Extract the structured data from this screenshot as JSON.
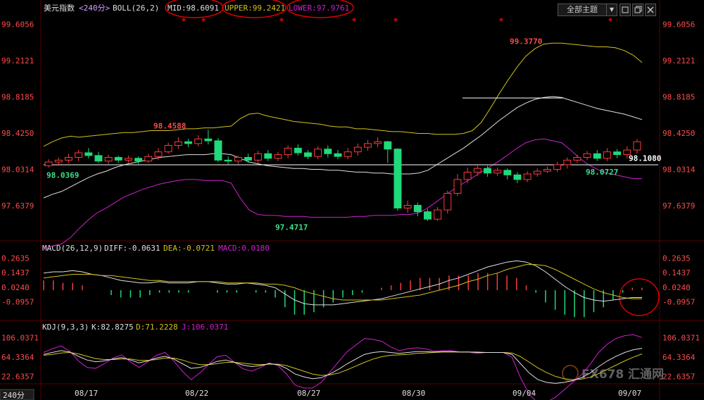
{
  "header": {
    "instrument": "美元指数",
    "period": "<240分>",
    "indicator": "BOLL(26,2)",
    "mid": "MID:98.6091",
    "upper": "UPPER:99.2421",
    "lower": "LOWER:97.9761",
    "theme_button": "全部主题",
    "theme_arrow": "▼"
  },
  "macd_header": {
    "name": "MACD(26,12,9)",
    "diff": "DIFF:-0.0631",
    "dea": "DEA:-0.0721",
    "macd": "MACD:0.0180"
  },
  "kdj_header": {
    "name": "KDJ(9,3,3)",
    "k": "K:82.8275",
    "d": "D:71.2228",
    "j": "J:106.0371"
  },
  "bottom_badge": "240分",
  "watermark": "FX678 汇通网",
  "colors": {
    "up": "#ff3a3a",
    "down": "#1fd97a",
    "mid": "#e0e0e0",
    "upper": "#d4c21a",
    "lower": "#d020d0",
    "annotation": "#ff0000"
  },
  "chart_data": [
    {
      "type": "candlestick",
      "title": "美元指数 <240分> BOLL(26,2)",
      "x_labels": [
        "08/17",
        "08/22",
        "08/27",
        "08/30",
        "09/04",
        "09/07"
      ],
      "y_ticks": [
        99.6056,
        99.2121,
        98.8185,
        98.425,
        98.0314,
        97.6379
      ],
      "ylim": [
        97.3,
        99.7
      ],
      "price_labels": [
        {
          "text": "98.0369",
          "value": 98.0369,
          "color": "green"
        },
        {
          "text": "98.4588",
          "value": 98.4588,
          "color": "red"
        },
        {
          "text": "97.4717",
          "value": 97.4717,
          "color": "green"
        },
        {
          "text": "99.3770",
          "value": 99.377,
          "color": "red"
        },
        {
          "text": "98.0727",
          "value": 98.0727,
          "color": "green"
        },
        {
          "text": "98.1080",
          "value": 98.108,
          "color": "white"
        }
      ],
      "horizontal_lines": [
        98.08,
        98.805
      ],
      "upper_band": [
        98.28,
        98.33,
        98.37,
        98.39,
        98.38,
        98.39,
        98.4,
        98.41,
        98.42,
        98.43,
        98.43,
        98.44,
        98.45,
        98.45,
        98.45,
        98.46,
        98.47,
        98.47,
        98.48,
        98.48,
        98.49,
        98.5,
        98.58,
        98.63,
        98.64,
        98.61,
        98.59,
        98.57,
        98.55,
        98.54,
        98.53,
        98.52,
        98.5,
        98.49,
        98.49,
        98.47,
        98.47,
        98.46,
        98.45,
        98.44,
        98.44,
        98.43,
        98.42,
        98.42,
        98.41,
        98.41,
        98.41,
        98.42,
        98.45,
        98.54,
        98.69,
        98.85,
        99.0,
        99.14,
        99.26,
        99.34,
        99.39,
        99.4,
        99.4,
        99.39,
        99.38,
        99.37,
        99.36,
        99.36,
        99.35,
        99.32,
        99.27,
        99.19
      ],
      "mid_band": [
        97.72,
        97.76,
        97.79,
        97.84,
        97.89,
        97.94,
        97.98,
        98.01,
        98.05,
        98.08,
        98.1,
        98.12,
        98.14,
        98.16,
        98.17,
        98.18,
        98.19,
        98.19,
        98.19,
        98.2,
        98.2,
        98.19,
        98.15,
        98.11,
        98.09,
        98.07,
        98.06,
        98.05,
        98.04,
        98.04,
        98.03,
        98.03,
        98.02,
        98.02,
        98.01,
        98.0,
        98.0,
        97.99,
        97.99,
        97.98,
        97.98,
        97.98,
        97.99,
        98.02,
        98.08,
        98.14,
        98.2,
        98.26,
        98.33,
        98.4,
        98.48,
        98.56,
        98.63,
        98.7,
        98.75,
        98.79,
        98.81,
        98.82,
        98.81,
        98.78,
        98.75,
        98.72,
        98.69,
        98.67,
        98.65,
        98.63,
        98.6,
        98.57
      ],
      "lower_band": [
        97.16,
        97.2,
        97.22,
        97.29,
        97.39,
        97.48,
        97.56,
        97.61,
        97.67,
        97.73,
        97.77,
        97.81,
        97.84,
        97.87,
        97.89,
        97.91,
        97.92,
        97.92,
        97.91,
        97.91,
        97.91,
        97.88,
        97.72,
        97.59,
        97.54,
        97.53,
        97.53,
        97.52,
        97.52,
        97.52,
        97.51,
        97.51,
        97.51,
        97.51,
        97.51,
        97.52,
        97.52,
        97.53,
        97.53,
        97.53,
        97.54,
        97.54,
        97.56,
        97.61,
        97.68,
        97.75,
        97.82,
        97.88,
        97.94,
        98.0,
        98.06,
        98.12,
        98.19,
        98.26,
        98.32,
        98.35,
        98.36,
        98.34,
        98.32,
        98.24,
        98.15,
        98.08,
        98.03,
        97.99,
        97.97,
        97.95,
        97.93,
        97.93
      ],
      "candles": [
        [
          98.07,
          98.11,
          98.05,
          98.14
        ],
        [
          98.11,
          98.13,
          98.08,
          98.16
        ],
        [
          98.13,
          98.16,
          98.1,
          98.2
        ],
        [
          98.16,
          98.21,
          98.12,
          98.24
        ],
        [
          98.21,
          98.18,
          98.15,
          98.26
        ],
        [
          98.18,
          98.12,
          98.1,
          98.22
        ],
        [
          98.12,
          98.16,
          98.09,
          98.19
        ],
        [
          98.16,
          98.13,
          98.1,
          98.18
        ],
        [
          98.13,
          98.15,
          98.1,
          98.18
        ],
        [
          98.15,
          98.12,
          98.09,
          98.17
        ],
        [
          98.12,
          98.17,
          98.1,
          98.2
        ],
        [
          98.17,
          98.22,
          98.13,
          98.26
        ],
        [
          98.22,
          98.29,
          98.2,
          98.32
        ],
        [
          98.29,
          98.33,
          98.25,
          98.38
        ],
        [
          98.33,
          98.31,
          98.27,
          98.36
        ],
        [
          98.31,
          98.36,
          98.28,
          98.4
        ],
        [
          98.36,
          98.34,
          98.3,
          98.46
        ],
        [
          98.34,
          98.13,
          98.11,
          98.37
        ],
        [
          98.13,
          98.12,
          98.08,
          98.17
        ],
        [
          98.12,
          98.16,
          98.09,
          98.18
        ],
        [
          98.16,
          98.13,
          98.1,
          98.2
        ],
        [
          98.13,
          98.2,
          98.1,
          98.23
        ],
        [
          98.2,
          98.15,
          98.12,
          98.24
        ],
        [
          98.15,
          98.19,
          98.12,
          98.22
        ],
        [
          98.19,
          98.26,
          98.15,
          98.29
        ],
        [
          98.26,
          98.21,
          98.18,
          98.3
        ],
        [
          98.21,
          98.17,
          98.14,
          98.24
        ],
        [
          98.17,
          98.25,
          98.14,
          98.28
        ],
        [
          98.25,
          98.2,
          98.16,
          98.29
        ],
        [
          98.2,
          98.17,
          98.14,
          98.24
        ],
        [
          98.17,
          98.22,
          98.14,
          98.26
        ],
        [
          98.22,
          98.27,
          98.18,
          98.31
        ],
        [
          98.27,
          98.31,
          98.23,
          98.35
        ],
        [
          98.31,
          98.33,
          98.27,
          98.38
        ],
        [
          98.33,
          98.25,
          98.1,
          98.34
        ],
        [
          98.25,
          97.61,
          97.58,
          98.26
        ],
        [
          97.61,
          97.64,
          97.56,
          97.69
        ],
        [
          97.64,
          97.57,
          97.52,
          97.67
        ],
        [
          97.57,
          97.49,
          97.47,
          97.6
        ],
        [
          97.49,
          97.59,
          97.47,
          97.62
        ],
        [
          97.59,
          97.77,
          97.55,
          97.8
        ],
        [
          97.77,
          97.92,
          97.74,
          97.98
        ],
        [
          97.92,
          98.0,
          97.88,
          98.05
        ],
        [
          98.0,
          98.04,
          97.96,
          98.08
        ],
        [
          98.04,
          97.99,
          97.95,
          98.07
        ],
        [
          97.99,
          98.02,
          97.96,
          98.05
        ],
        [
          98.02,
          97.97,
          97.92,
          98.04
        ],
        [
          97.97,
          97.92,
          97.88,
          98.0
        ],
        [
          97.92,
          97.98,
          97.89,
          98.01
        ],
        [
          97.98,
          98.01,
          97.95,
          98.04
        ],
        [
          98.01,
          98.03,
          97.99,
          98.06
        ],
        [
          98.03,
          98.08,
          98.0,
          98.11
        ],
        [
          98.08,
          98.13,
          98.04,
          98.16
        ],
        [
          98.13,
          98.16,
          98.1,
          98.19
        ],
        [
          98.16,
          98.2,
          98.13,
          98.23
        ],
        [
          98.2,
          98.15,
          98.12,
          98.24
        ],
        [
          98.15,
          98.22,
          98.12,
          98.26
        ],
        [
          98.22,
          98.19,
          98.15,
          98.25
        ],
        [
          98.19,
          98.24,
          98.15,
          98.28
        ],
        [
          98.24,
          98.33,
          98.2,
          98.36
        ]
      ]
    },
    {
      "type": "line",
      "title": "MACD(26,12,9)",
      "y_ticks": [
        0.2635,
        0.1437,
        0.024,
        -0.0957
      ],
      "ylim": [
        -0.23,
        0.3
      ],
      "series": [
        {
          "name": "DIFF",
          "values": [
            0.14,
            0.15,
            0.15,
            0.16,
            0.15,
            0.13,
            0.12,
            0.1,
            0.08,
            0.07,
            0.06,
            0.06,
            0.07,
            0.06,
            0.06,
            0.06,
            0.07,
            0.07,
            0.06,
            0.05,
            0.05,
            0.06,
            0.05,
            0.04,
            0.02,
            -0.03,
            -0.08,
            -0.11,
            -0.12,
            -0.12,
            -0.12,
            -0.11,
            -0.1,
            -0.09,
            -0.08,
            -0.07,
            -0.05,
            -0.03,
            -0.01,
            0.01,
            0.03,
            0.05,
            0.08,
            0.1,
            0.13,
            0.16,
            0.19,
            0.21,
            0.23,
            0.24,
            0.23,
            0.2,
            0.15,
            0.09,
            0.03,
            -0.02,
            -0.06,
            -0.08,
            -0.09,
            -0.08,
            -0.07,
            -0.06,
            -0.06
          ]
        },
        {
          "name": "DEA",
          "values": [
            0.1,
            0.11,
            0.12,
            0.13,
            0.13,
            0.13,
            0.12,
            0.12,
            0.11,
            0.1,
            0.09,
            0.08,
            0.08,
            0.07,
            0.07,
            0.07,
            0.07,
            0.07,
            0.07,
            0.06,
            0.06,
            0.06,
            0.06,
            0.05,
            0.05,
            0.04,
            0.02,
            -0.01,
            -0.03,
            -0.05,
            -0.07,
            -0.08,
            -0.08,
            -0.08,
            -0.08,
            -0.08,
            -0.07,
            -0.06,
            -0.05,
            -0.04,
            -0.02,
            0.0,
            0.02,
            0.04,
            0.07,
            0.09,
            0.12,
            0.14,
            0.17,
            0.19,
            0.21,
            0.21,
            0.2,
            0.17,
            0.13,
            0.09,
            0.05,
            0.01,
            -0.02,
            -0.04,
            -0.06,
            -0.07,
            -0.07
          ]
        },
        {
          "name": "MACD",
          "values": [
            0.08,
            0.08,
            0.06,
            0.06,
            0.04,
            0.0,
            0.0,
            -0.04,
            -0.06,
            -0.06,
            -0.06,
            -0.04,
            -0.02,
            -0.02,
            -0.02,
            -0.02,
            0.0,
            0.0,
            -0.02,
            -0.02,
            -0.02,
            0.0,
            -0.02,
            -0.02,
            -0.06,
            -0.14,
            -0.2,
            -0.2,
            -0.18,
            -0.14,
            -0.1,
            -0.06,
            -0.04,
            -0.02,
            0.0,
            0.02,
            0.04,
            0.06,
            0.08,
            0.1,
            0.1,
            0.1,
            0.12,
            0.12,
            0.12,
            0.14,
            0.14,
            0.14,
            0.12,
            0.1,
            0.04,
            -0.02,
            -0.1,
            -0.16,
            -0.2,
            -0.22,
            -0.22,
            -0.18,
            -0.14,
            -0.08,
            -0.02,
            0.02,
            0.02
          ]
        }
      ]
    },
    {
      "type": "line",
      "title": "KDJ(9,3,3)",
      "y_ticks": [
        106.0371,
        64.3364,
        22.6357
      ],
      "ylim": [
        -5,
        120
      ],
      "series": [
        {
          "name": "K",
          "values": [
            70,
            74,
            78,
            75,
            66,
            58,
            54,
            56,
            60,
            63,
            58,
            52,
            56,
            62,
            66,
            60,
            50,
            40,
            42,
            48,
            55,
            58,
            53,
            47,
            44,
            46,
            50,
            48,
            40,
            28,
            22,
            18,
            20,
            28,
            38,
            50,
            60,
            70,
            74,
            76,
            74,
            72,
            74,
            76,
            76,
            75,
            76,
            76,
            75,
            75,
            74,
            74,
            74,
            74,
            70,
            50,
            30,
            16,
            10,
            8,
            10,
            14,
            20,
            30,
            44,
            56,
            66,
            74,
            80,
            83
          ]
        },
        {
          "name": "D",
          "values": [
            68,
            70,
            73,
            74,
            71,
            66,
            61,
            59,
            59,
            60,
            60,
            57,
            57,
            59,
            62,
            62,
            58,
            52,
            48,
            48,
            50,
            53,
            53,
            51,
            49,
            48,
            49,
            49,
            46,
            40,
            34,
            28,
            25,
            26,
            30,
            37,
            45,
            53,
            60,
            65,
            68,
            69,
            70,
            72,
            73,
            74,
            75,
            75,
            75,
            75,
            75,
            74,
            74,
            74,
            73,
            65,
            53,
            41,
            31,
            23,
            18,
            16,
            17,
            21,
            29,
            38,
            47,
            56,
            64,
            71
          ]
        },
        {
          "name": "J",
          "values": [
            74,
            82,
            88,
            77,
            56,
            42,
            40,
            50,
            62,
            69,
            54,
            42,
            54,
            68,
            74,
            56,
            34,
            16,
            30,
            48,
            65,
            68,
            53,
            39,
            34,
            42,
            52,
            46,
            28,
            4,
            -2,
            -2,
            10,
            32,
            54,
            76,
            90,
            104,
            102,
            98,
            86,
            78,
            82,
            84,
            82,
            77,
            78,
            78,
            75,
            75,
            72,
            74,
            74,
            74,
            64,
            20,
            -16,
            -34,
            -32,
            -22,
            -6,
            10,
            26,
            48,
            74,
            92,
            104,
            110,
            112,
            106
          ]
        }
      ]
    }
  ]
}
